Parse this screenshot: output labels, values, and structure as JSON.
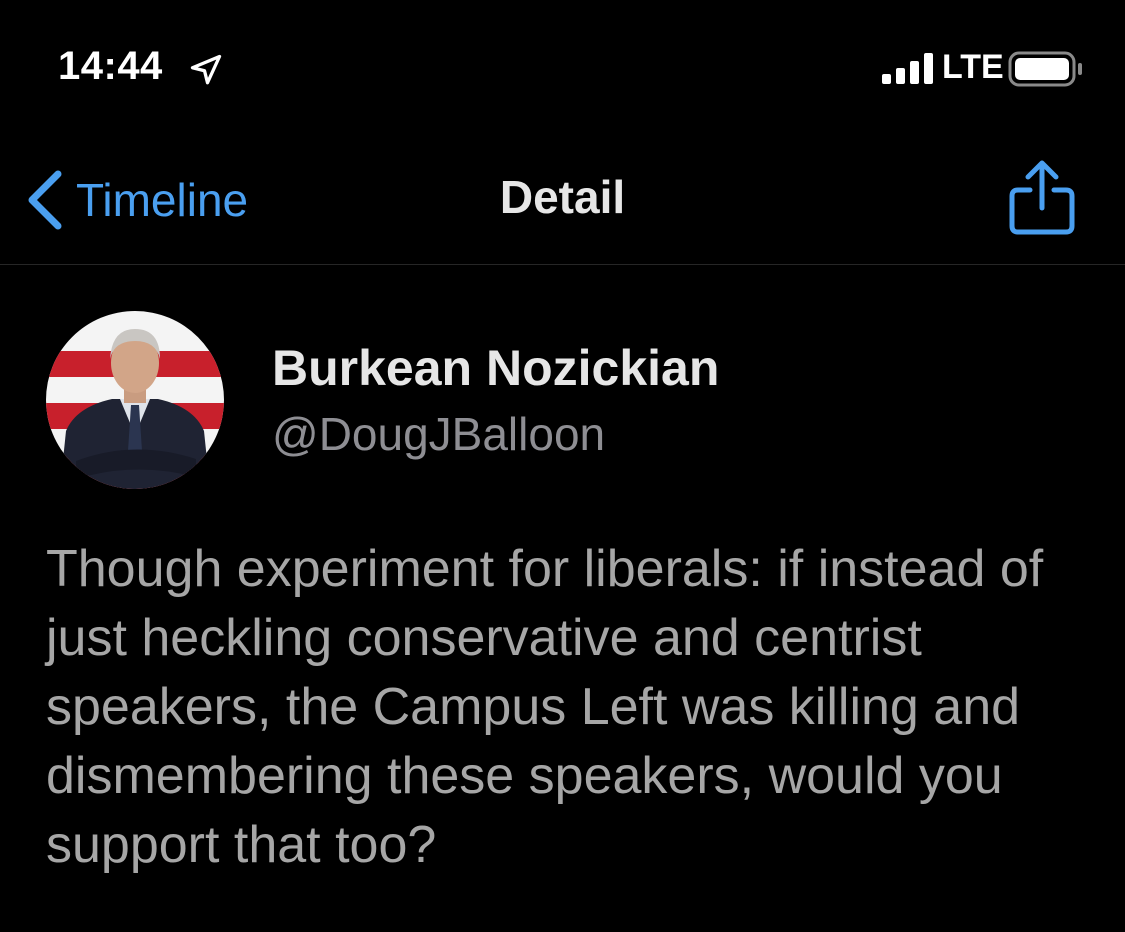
{
  "status_bar": {
    "time": "14:44",
    "network": "LTE",
    "icons": [
      "location-arrow-icon",
      "cellular-signal-icon",
      "battery-icon"
    ]
  },
  "nav": {
    "back_label": "Timeline",
    "title": "Detail",
    "share_icon": "share-icon"
  },
  "tweet": {
    "display_name": "Burkean Nozickian",
    "handle": "@DougJBalloon",
    "text": "Though experiment for liberals: if instead of just heckling conservative and centrist speakers, the Campus Left was killing and dismembering these speakers, would you support that too?"
  },
  "colors": {
    "background": "#000000",
    "accent": "#4a9ff0",
    "primary_text": "#e6e6e6",
    "secondary_text": "#8e8e93",
    "body_text": "#a6a6a6"
  }
}
